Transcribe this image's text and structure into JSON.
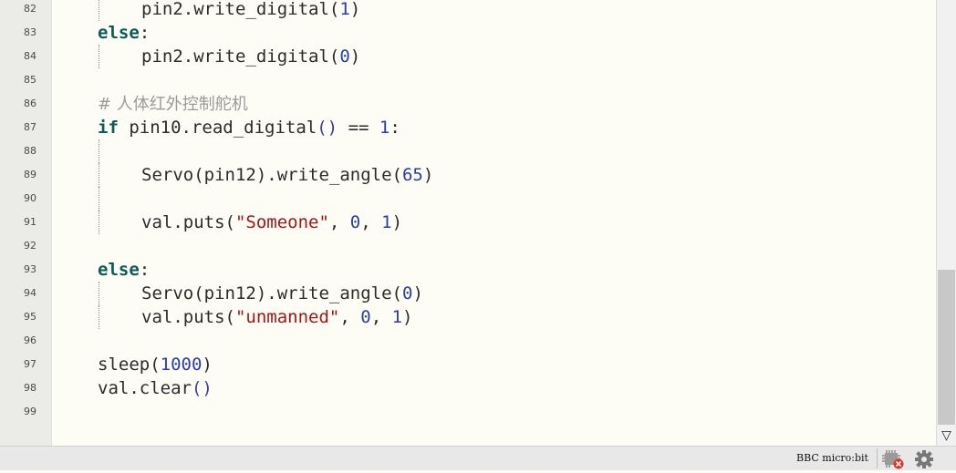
{
  "editor": {
    "lines": [
      {
        "num": "82",
        "indent": 1,
        "guide": true,
        "tokens": [
          [
            "t",
            "pin2.write_digital("
          ],
          [
            "num",
            "1"
          ],
          [
            "t",
            ")"
          ]
        ]
      },
      {
        "num": "83",
        "indent": 0,
        "guide": false,
        "tokens": [
          [
            "kw",
            "else"
          ],
          [
            "t",
            ":"
          ]
        ]
      },
      {
        "num": "84",
        "indent": 1,
        "guide": true,
        "tokens": [
          [
            "t",
            "pin2.write_digital("
          ],
          [
            "num",
            "0"
          ],
          [
            "t",
            ")"
          ]
        ]
      },
      {
        "num": "85",
        "indent": 0,
        "guide": false,
        "tokens": []
      },
      {
        "num": "86",
        "indent": 0,
        "guide": false,
        "tokens": [
          [
            "cm",
            "# 人体红外控制舵机"
          ]
        ]
      },
      {
        "num": "87",
        "indent": 0,
        "guide": false,
        "tokens": [
          [
            "kw",
            "if"
          ],
          [
            "t",
            " pin10.read_digital"
          ],
          [
            "pn",
            "()"
          ],
          [
            "t",
            " == "
          ],
          [
            "num",
            "1"
          ],
          [
            "t",
            ":"
          ]
        ]
      },
      {
        "num": "88",
        "indent": 0,
        "guide": true,
        "tokens": []
      },
      {
        "num": "89",
        "indent": 1,
        "guide": true,
        "tokens": [
          [
            "t",
            "Servo(pin12).write_angle("
          ],
          [
            "num",
            "65"
          ],
          [
            "t",
            ")"
          ]
        ]
      },
      {
        "num": "90",
        "indent": 0,
        "guide": true,
        "tokens": []
      },
      {
        "num": "91",
        "indent": 1,
        "guide": true,
        "tokens": [
          [
            "t",
            "val.puts("
          ],
          [
            "str",
            "\"Someone\""
          ],
          [
            "t",
            ", "
          ],
          [
            "num",
            "0"
          ],
          [
            "t",
            ", "
          ],
          [
            "num",
            "1"
          ],
          [
            "t",
            ")"
          ]
        ]
      },
      {
        "num": "92",
        "indent": 0,
        "guide": false,
        "tokens": []
      },
      {
        "num": "93",
        "indent": 0,
        "guide": false,
        "tokens": [
          [
            "kw",
            "else"
          ],
          [
            "t",
            ":"
          ]
        ]
      },
      {
        "num": "94",
        "indent": 1,
        "guide": true,
        "tokens": [
          [
            "t",
            "Servo(pin12).write_angle("
          ],
          [
            "num",
            "0"
          ],
          [
            "t",
            ")"
          ]
        ]
      },
      {
        "num": "95",
        "indent": 1,
        "guide": true,
        "tokens": [
          [
            "t",
            "val.puts("
          ],
          [
            "str",
            "\"unmanned\""
          ],
          [
            "t",
            ", "
          ],
          [
            "num",
            "0"
          ],
          [
            "t",
            ", "
          ],
          [
            "num",
            "1"
          ],
          [
            "t",
            ")"
          ]
        ]
      },
      {
        "num": "96",
        "indent": 0,
        "guide": false,
        "tokens": []
      },
      {
        "num": "97",
        "indent": 0,
        "guide": false,
        "tokens": [
          [
            "t",
            "sleep("
          ],
          [
            "num",
            "1000"
          ],
          [
            "t",
            ")"
          ]
        ]
      },
      {
        "num": "98",
        "indent": 0,
        "guide": false,
        "tokens": [
          [
            "t",
            "val.clear"
          ],
          [
            "pn",
            "()"
          ]
        ]
      },
      {
        "num": "99",
        "indent": 0,
        "guide": false,
        "tokens": []
      }
    ]
  },
  "scrollbar": {
    "down_arrow": "▽"
  },
  "statusbar": {
    "board_label": "BBC micro:bit",
    "icons": [
      "device-disconnected-icon",
      "gear-icon"
    ]
  },
  "colors": {
    "keyword": "#0b5c57",
    "number": "#2a3ea8",
    "string": "#a31515",
    "comment": "#9a9a9a",
    "background": "#fdfdf6"
  }
}
